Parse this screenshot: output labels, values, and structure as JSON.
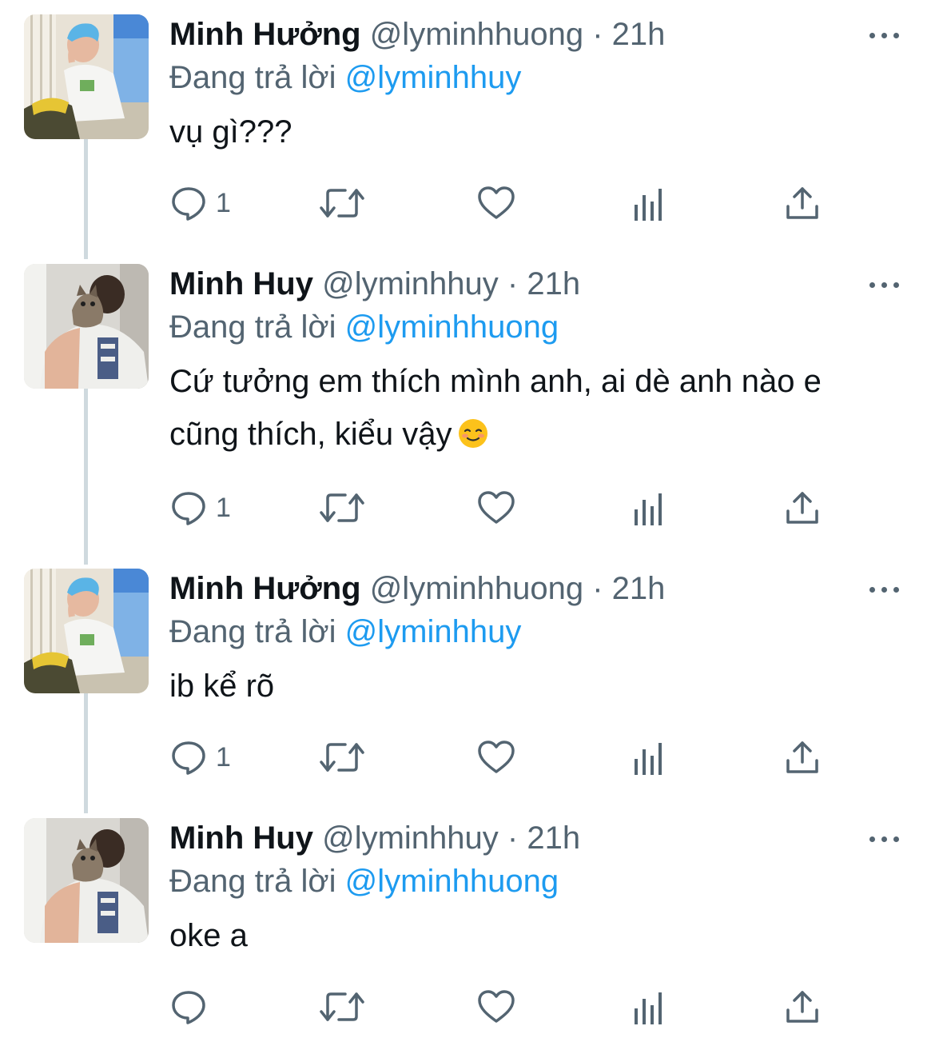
{
  "reply_prefix": "Đang trả lời",
  "icons": {
    "reply": "reply-icon",
    "retweet": "retweet-icon",
    "like": "heart-icon",
    "views": "analytics-icon",
    "share": "share-icon",
    "more": "more-icon"
  },
  "colors": {
    "mention": "#1d9bf0",
    "secondary_text": "#536471",
    "thread_line": "#cfd9de"
  },
  "tweets": [
    {
      "name": "Minh Hưởng",
      "handle": "@lyminhhuong",
      "time": "· 21h",
      "reply_to": "@lyminhhuy",
      "text": "vụ gì???",
      "reply_count": "1",
      "avatar": "blue-hair-avatar"
    },
    {
      "name": "Minh Huy",
      "handle": "@lyminhhuy",
      "time": "· 21h",
      "reply_to": "@lyminhhuong",
      "text": "Cứ tưởng em thích mình anh, ai dè anh nào e cũng thích, kiểu vậy",
      "emoji": "smiling-face-emoji",
      "reply_count": "1",
      "avatar": "cat-avatar"
    },
    {
      "name": "Minh Hưởng",
      "handle": "@lyminhhuong",
      "time": "· 21h",
      "reply_to": "@lyminhhuy",
      "text": "ib kể rõ",
      "reply_count": "1",
      "avatar": "blue-hair-avatar"
    },
    {
      "name": "Minh Huy",
      "handle": "@lyminhhuy",
      "time": "· 21h",
      "reply_to": "@lyminhhuong",
      "text": "oke a",
      "reply_count": "",
      "avatar": "cat-avatar"
    }
  ]
}
